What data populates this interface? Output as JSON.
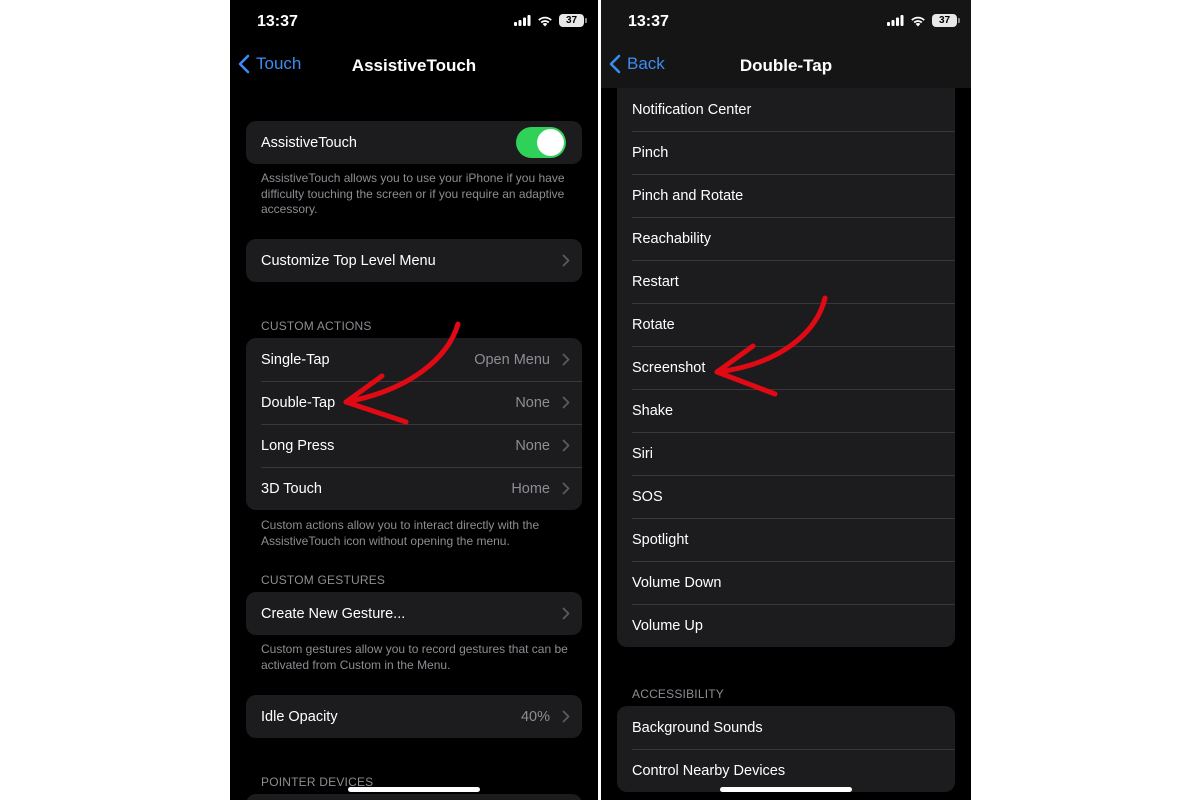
{
  "status": {
    "time": "13:37",
    "battery": "37"
  },
  "left": {
    "back_label": "Touch",
    "title": "AssistiveTouch",
    "toggle_label": "AssistiveTouch",
    "toggle_desc": "AssistiveTouch allows you to use your iPhone if you have difficulty touching the screen or if you require an adaptive accessory.",
    "customize_label": "Customize Top Level Menu",
    "custom_actions_header": "CUSTOM ACTIONS",
    "actions": [
      {
        "label": "Single-Tap",
        "value": "Open Menu"
      },
      {
        "label": "Double-Tap",
        "value": "None"
      },
      {
        "label": "Long Press",
        "value": "None"
      },
      {
        "label": "3D Touch",
        "value": "Home"
      }
    ],
    "actions_desc": "Custom actions allow you to interact directly with the AssistiveTouch icon without opening the menu.",
    "custom_gestures_header": "CUSTOM GESTURES",
    "create_gesture_label": "Create New Gesture...",
    "gestures_desc": "Custom gestures allow you to record gestures that can be activated from Custom in the Menu.",
    "idle_opacity_label": "Idle Opacity",
    "idle_opacity_value": "40%",
    "pointer_devices_header": "POINTER DEVICES"
  },
  "right": {
    "back_label": "Back",
    "title": "Double-Tap",
    "options": [
      "Notification Center",
      "Pinch",
      "Pinch and Rotate",
      "Reachability",
      "Restart",
      "Rotate",
      "Screenshot",
      "Shake",
      "Siri",
      "SOS",
      "Spotlight",
      "Volume Down",
      "Volume Up"
    ],
    "accessibility_header": "ACCESSIBILITY",
    "accessibility_items": [
      "Background Sounds",
      "Control Nearby Devices"
    ]
  },
  "colors": {
    "accent": "#3b8cf5",
    "toggle_on": "#30d158",
    "annotation": "#e10a14",
    "background": "#000000",
    "cell": "#1c1c1e"
  }
}
